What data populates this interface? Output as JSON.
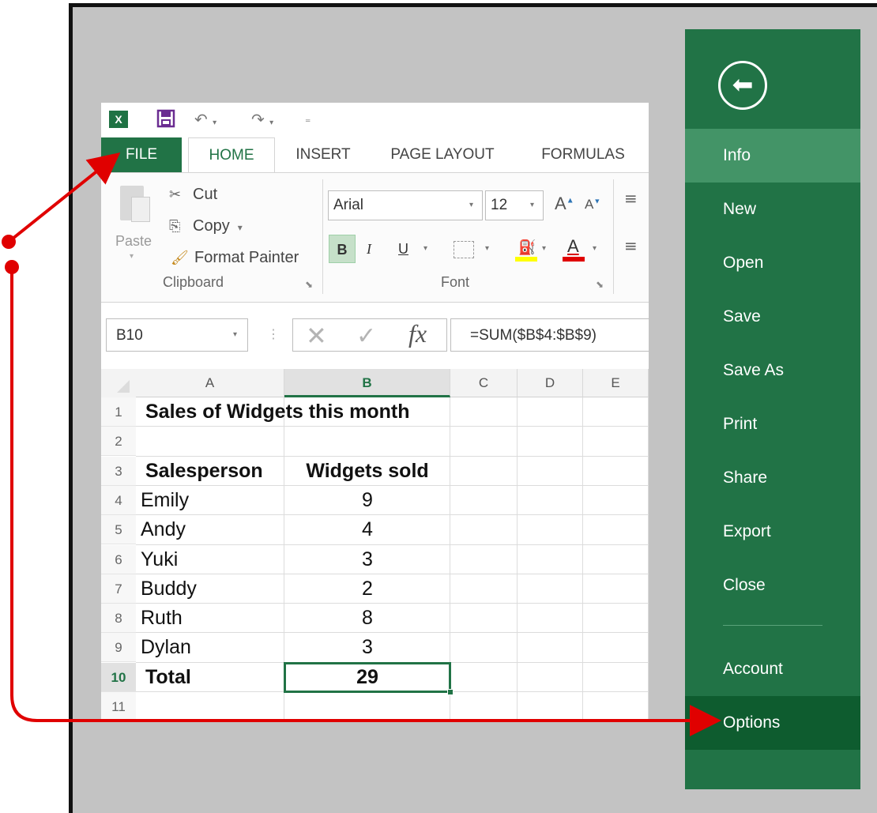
{
  "qat": {
    "excel_logo": "X",
    "icons": [
      "excel-icon",
      "save-icon",
      "undo-icon",
      "redo-icon",
      "customize-qat-icon"
    ]
  },
  "tabs": [
    "FILE",
    "HOME",
    "INSERT",
    "PAGE LAYOUT",
    "FORMULAS"
  ],
  "clipboard": {
    "paste": "Paste",
    "cut": "Cut",
    "copy": "Copy",
    "format_painter": "Format Painter",
    "group_label": "Clipboard"
  },
  "font": {
    "name": "Arial",
    "size": "12",
    "bold": "B",
    "italic": "I",
    "underline": "U",
    "font_color_letter": "A",
    "grow_letter": "A",
    "shrink_letter": "A",
    "group_label": "Font",
    "fill_color": "#ffff00",
    "text_color": "#e00000"
  },
  "formula_bar": {
    "name_box": "B10",
    "fx": "fx",
    "formula": "=SUM($B$4:$B$9)"
  },
  "sheet": {
    "columns": [
      "A",
      "B",
      "C",
      "D",
      "E"
    ],
    "selected_column": "B",
    "rows": [
      {
        "num": "1",
        "a": "Sales of Widgets this month",
        "b": ""
      },
      {
        "num": "2",
        "a": "",
        "b": ""
      },
      {
        "num": "3",
        "a": "Salesperson",
        "b": "Widgets sold"
      },
      {
        "num": "4",
        "a": "Emily",
        "b": "9"
      },
      {
        "num": "5",
        "a": "Andy",
        "b": "4"
      },
      {
        "num": "6",
        "a": "Yuki",
        "b": "3"
      },
      {
        "num": "7",
        "a": "Buddy",
        "b": "2"
      },
      {
        "num": "8",
        "a": "Ruth",
        "b": "8"
      },
      {
        "num": "9",
        "a": "Dylan",
        "b": "3"
      },
      {
        "num": "10",
        "a": "Total",
        "b": "29"
      },
      {
        "num": "11",
        "a": "",
        "b": ""
      }
    ],
    "selected_cell": "B10"
  },
  "backstage": {
    "back_icon": "back-arrow-icon",
    "items": [
      "Info",
      "New",
      "Open",
      "Save",
      "Save As",
      "Print",
      "Share",
      "Export",
      "Close",
      "Account",
      "Options"
    ],
    "active": "Info",
    "highlighted": "Options"
  },
  "colors": {
    "excel_green": "#217346",
    "annotation_red": "#e00000",
    "backstage_active": "#439467",
    "backstage_highlight": "#0e5c2f"
  }
}
